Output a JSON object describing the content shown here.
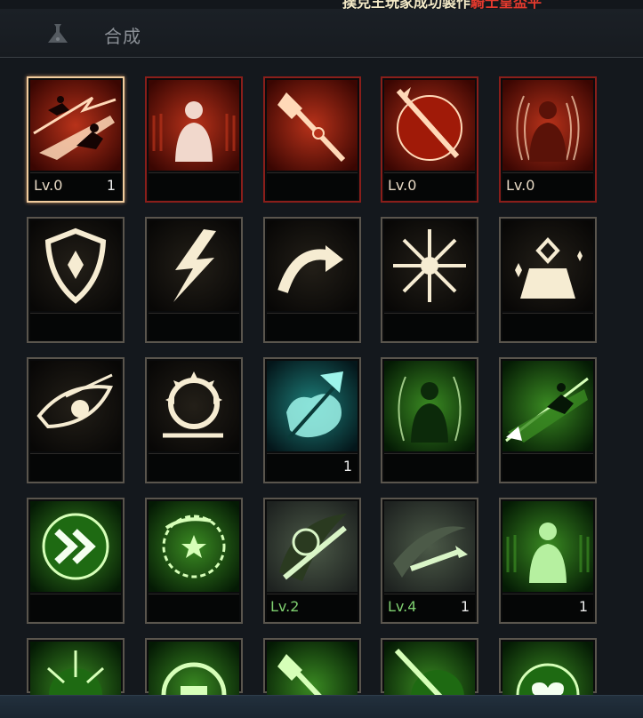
{
  "ticker": {
    "part_white": "撲克王玩家成功製作",
    "part_red": "騎士皇盃平"
  },
  "header": {
    "title": "合成",
    "icon": "flask-icon"
  },
  "colors": {
    "red_border": "#8a1e1a",
    "gray_border": "#5a554d",
    "selected_border": "#f0cc9e",
    "level_green": "#7fd070"
  },
  "rows": [
    [
      {
        "name": "dash-skill",
        "icon": "sprinting-figure-icon",
        "level": "Lv.0",
        "count": "1"
      },
      {
        "name": "crowd-skill",
        "icon": "standing-figure-icon",
        "level": "",
        "count": ""
      },
      {
        "name": "staff-skill",
        "icon": "ornate-staff-icon",
        "level": "",
        "count": ""
      },
      {
        "name": "sword-orb-skill",
        "icon": "sword-orb-icon",
        "level": "Lv.0",
        "count": ""
      },
      {
        "name": "aura-skill",
        "icon": "aura-figure-icon",
        "level": "Lv.0",
        "count": ""
      }
    ],
    [
      {
        "name": "shield-skill",
        "icon": "shield-icon",
        "level": "",
        "count": ""
      },
      {
        "name": "lightning-skill",
        "icon": "lightning-icon",
        "level": "",
        "count": ""
      },
      {
        "name": "curve-arrow-skill",
        "icon": "curved-arrow-icon",
        "level": "",
        "count": ""
      },
      {
        "name": "burst-skill",
        "icon": "burst-icon",
        "level": "",
        "count": ""
      },
      {
        "name": "bell-skill",
        "icon": "bell-sparkle-icon",
        "level": "",
        "count": ""
      }
    ],
    [
      {
        "name": "eye-skill",
        "icon": "eye-icon",
        "level": "",
        "count": ""
      },
      {
        "name": "gear-skill",
        "icon": "spiked-gear-icon",
        "level": "",
        "count": ""
      },
      {
        "name": "crystal-skill",
        "icon": "crystal-cross-icon",
        "level": "",
        "count": "1"
      },
      {
        "name": "green-aura-skill",
        "icon": "green-aura-figure-icon",
        "level": "",
        "count": ""
      },
      {
        "name": "green-dash-skill",
        "icon": "green-sprint-icon",
        "level": "",
        "count": ""
      }
    ],
    [
      {
        "name": "speed-skill",
        "icon": "double-chevron-icon",
        "level": "",
        "count": ""
      },
      {
        "name": "rune-circle-skill",
        "icon": "rune-star-icon",
        "level": "",
        "count": ""
      },
      {
        "name": "rune-slash-skill",
        "icon": "rune-slash-icon",
        "level": "Lv.2",
        "count": ""
      },
      {
        "name": "blade-slash-skill",
        "icon": "blade-slash-icon",
        "level": "Lv.4",
        "count": "1"
      },
      {
        "name": "green-crowd-skill",
        "icon": "green-figure-icon",
        "level": "",
        "count": "1"
      }
    ],
    [
      {
        "name": "burst-orb-skill",
        "icon": "burst-orb-icon",
        "level": "",
        "count": ""
      },
      {
        "name": "emblem-skill",
        "icon": "emblem-icon",
        "level": "",
        "count": ""
      },
      {
        "name": "staff-green-skill",
        "icon": "green-staff-icon",
        "level": "",
        "count": ""
      },
      {
        "name": "sword-green-skill",
        "icon": "green-sword-icon",
        "level": "",
        "count": ""
      },
      {
        "name": "heart-skill",
        "icon": "heart-orb-icon",
        "level": "",
        "count": ""
      }
    ]
  ]
}
